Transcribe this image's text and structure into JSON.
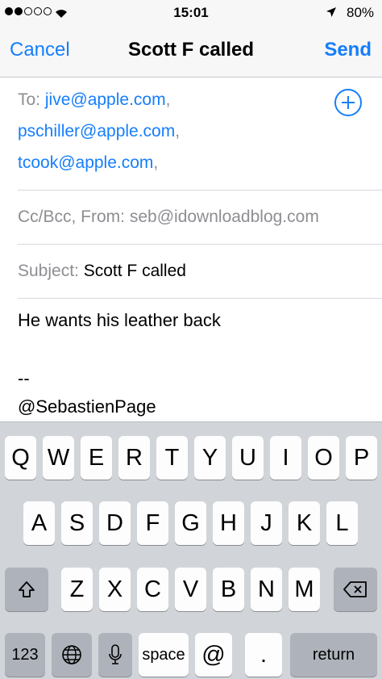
{
  "status_bar": {
    "time": "15:01",
    "battery": "80%"
  },
  "nav": {
    "cancel": "Cancel",
    "title": "Scott F called",
    "send": "Send"
  },
  "compose": {
    "to_label": "To:",
    "recipients": [
      "jive@apple.com",
      "pschiller@apple.com",
      "tcook@apple.com"
    ],
    "separator": ",",
    "cc_label": "Cc/Bcc, From:",
    "from_value": "seb@idownloadblog.com",
    "subject_label": "Subject:",
    "subject_value": "Scott F called",
    "body_lines": [
      "He wants his leather back",
      "--",
      "@SebastienPage"
    ]
  },
  "keyboard": {
    "row1": [
      "Q",
      "W",
      "E",
      "R",
      "T",
      "Y",
      "U",
      "I",
      "O",
      "P"
    ],
    "row2": [
      "A",
      "S",
      "D",
      "F",
      "G",
      "H",
      "J",
      "K",
      "L"
    ],
    "row3": [
      "Z",
      "X",
      "C",
      "V",
      "B",
      "N",
      "M"
    ],
    "numbers": "123",
    "space": "space",
    "at": "@",
    "period": ".",
    "return": "return"
  },
  "icons": [
    "wifi-icon",
    "location-arrow-icon",
    "battery-icon",
    "add-contact-icon",
    "shift-icon",
    "delete-icon",
    "globe-icon",
    "microphone-icon"
  ],
  "colors": {
    "accent": "#157efb",
    "label_gray": "#8e8e93",
    "keyboard_bg": "#d1d4d9"
  }
}
